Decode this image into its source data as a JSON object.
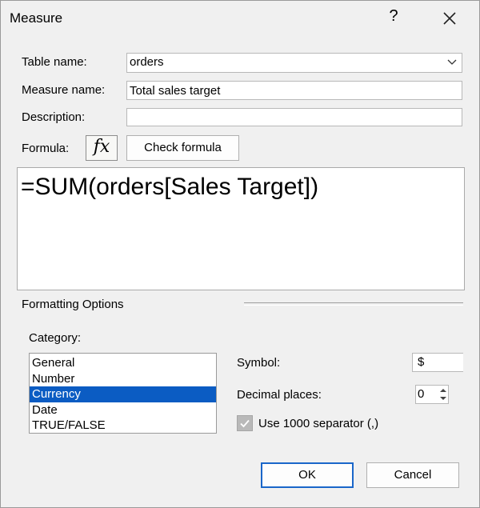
{
  "window": {
    "title": "Measure",
    "help_glyph": "?",
    "close_icon": "close-icon"
  },
  "form": {
    "table_name_label": "Table name:",
    "table_name_value": "orders",
    "measure_name_label": "Measure name:",
    "measure_name_value": "Total sales target",
    "description_label": "Description:",
    "description_value": "",
    "formula_label": "Formula:",
    "fx_label": "fx",
    "check_formula_label": "Check formula",
    "formula_text": "=SUM(orders[Sales Target])"
  },
  "formatting": {
    "group_title": "Formatting Options",
    "category_label": "Category:",
    "categories": [
      "General",
      "Number",
      "Currency",
      "Date",
      "TRUE/FALSE"
    ],
    "selected_category": "Currency",
    "symbol_label": "Symbol:",
    "symbol_value": "$",
    "decimal_places_label": "Decimal places:",
    "decimal_places_value": "0",
    "separator_label": "Use 1000 separator (,)",
    "separator_checked": true
  },
  "footer": {
    "ok_label": "OK",
    "cancel_label": "Cancel"
  },
  "colors": {
    "selection": "#0b5cc3",
    "background": "#f0f0f0",
    "ok_border": "#1a66c9"
  }
}
